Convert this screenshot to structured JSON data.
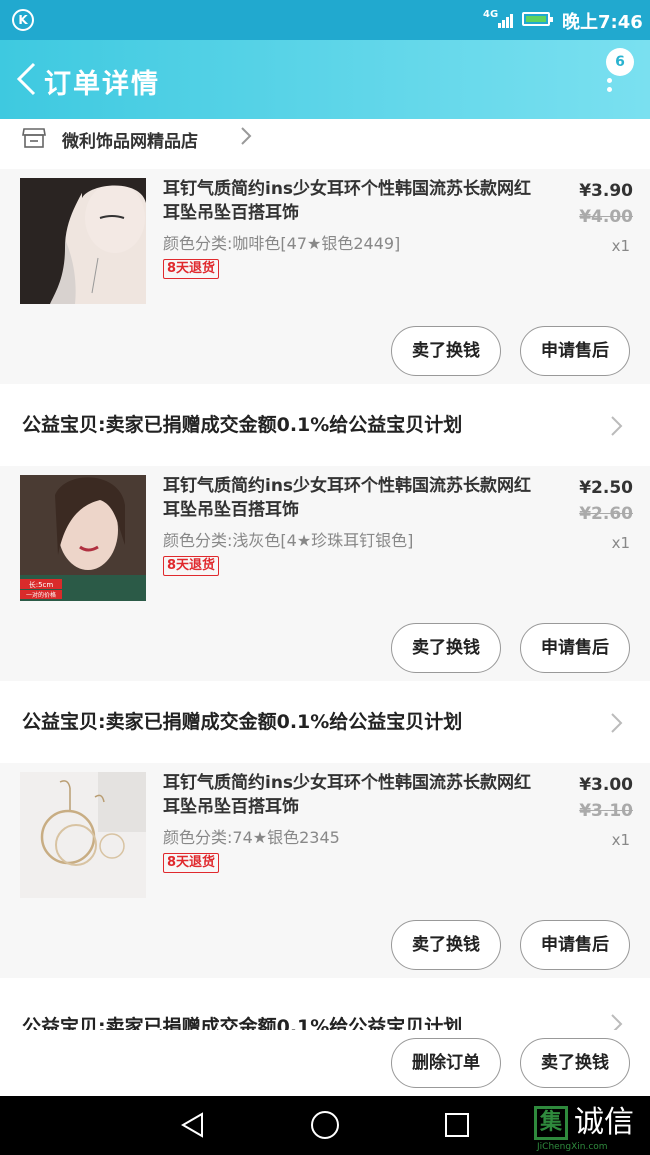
{
  "status_bar": {
    "left_icon": "K",
    "network": "4G",
    "time": "晚上7:46",
    "battery_color": "#5fd35f"
  },
  "header": {
    "title": "订单详情",
    "badge": "6",
    "back_icon": "chevron-left-icon",
    "more_icon": "more-vertical-icon"
  },
  "shop": {
    "name": "微利饰品网精品店",
    "icon": "store-icon"
  },
  "colors": {
    "accent": "#3ec9e0",
    "tag_red": "#e0292d"
  },
  "items": [
    {
      "title": "耳钉气质简约ins少女耳环个性韩国流苏长款网红耳坠吊坠百搭耳饰",
      "sku": "颜色分类:咖啡色[47★银色2449]",
      "tag": "8天退货",
      "price": "¥3.90",
      "original_price": "¥4.00",
      "quantity": "x1",
      "btn_left": "卖了换钱",
      "btn_right": "申请售后"
    },
    {
      "title": "耳钉气质简约ins少女耳环个性韩国流苏长款网红耳坠吊坠百搭耳饰",
      "sku": "颜色分类:浅灰色[4★珍珠耳钉银色]",
      "tag": "8天退货",
      "price": "¥2.50",
      "original_price": "¥2.60",
      "quantity": "x1",
      "image_caption_1": "长:5cm",
      "image_caption_2": "一对的价格",
      "btn_left": "卖了换钱",
      "btn_right": "申请售后"
    },
    {
      "title": "耳钉气质简约ins少女耳环个性韩国流苏长款网红耳坠吊坠百搭耳饰",
      "sku": "颜色分类:74★银色2345",
      "tag": "8天退货",
      "price": "¥3.00",
      "original_price": "¥3.10",
      "quantity": "x1",
      "btn_left": "卖了换钱",
      "btn_right": "申请售后"
    }
  ],
  "charity_text": "公益宝贝:卖家已捐赠成交金额0.1%给公益宝贝计划",
  "bottom_bar": {
    "delete_label": "删除订单",
    "sell_label": "卖了换钱"
  },
  "watermark": {
    "mark": "集",
    "text": "诚信",
    "sub": "JiChengXin.com"
  }
}
